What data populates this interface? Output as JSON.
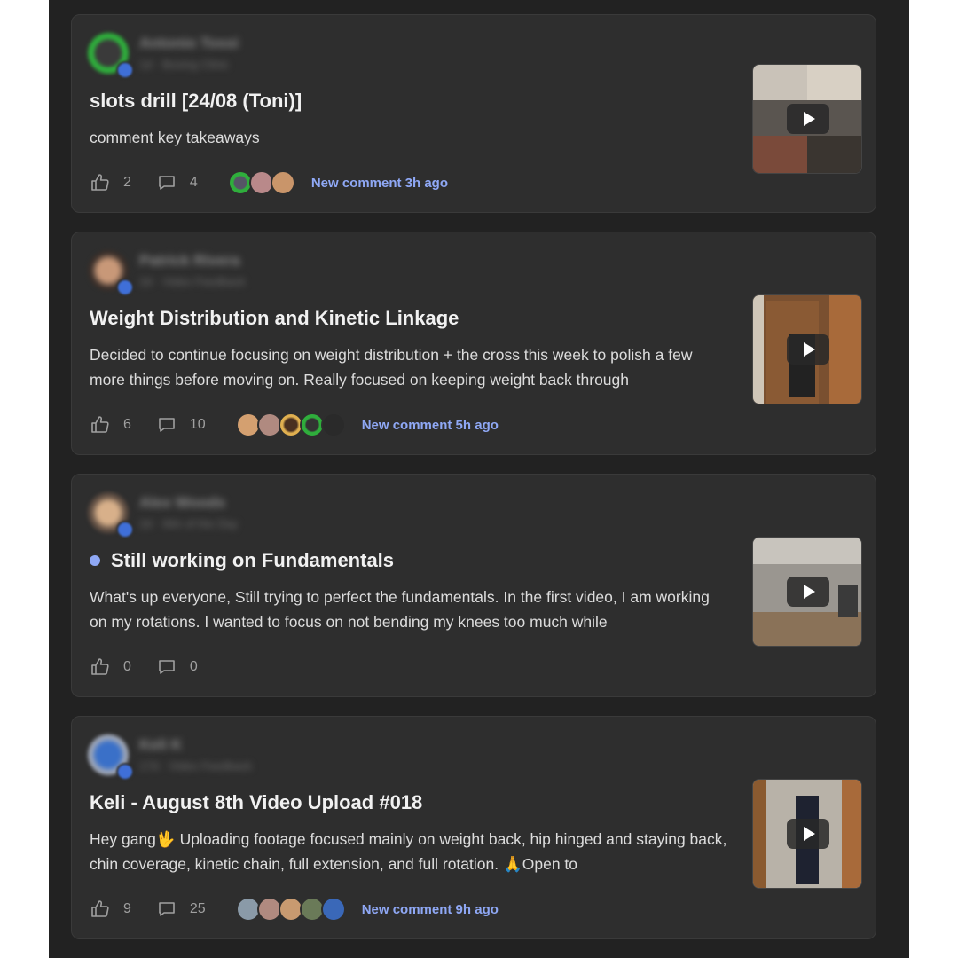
{
  "posts": [
    {
      "author_name": "Antonio Tossi",
      "author_meta": "1d · Boxing Clinic",
      "title": "slots drill [24/08 (Toni)]",
      "unread": false,
      "body": "comment key takeaways",
      "likes": "2",
      "comments": "4",
      "commenter_icons": [
        "avatar",
        "avatar",
        "avatar"
      ],
      "new_comment": "New comment 3h ago"
    },
    {
      "author_name": "Patrick Rivera",
      "author_meta": "2d · Video Feedback",
      "title": "Weight Distribution and Kinetic Linkage",
      "unread": false,
      "body": "Decided to continue focusing on weight distribution + the cross this week to polish a few more things before moving on. Really focused on keeping weight back through",
      "likes": "6",
      "comments": "10",
      "commenter_icons": [
        "avatar",
        "avatar",
        "avatar",
        "avatar",
        "avatar"
      ],
      "new_comment": "New comment 5h ago"
    },
    {
      "author_name": "Alex Woods",
      "author_meta": "2d · Win of the Day",
      "title": "Still working on Fundamentals",
      "unread": true,
      "body": "What's up everyone, Still trying to perfect the fundamentals. In the first video, I am working on my rotations. I wanted to focus on not bending my knees too much while",
      "likes": "0",
      "comments": "0",
      "commenter_icons": [],
      "new_comment": ""
    },
    {
      "author_name": "Keli K",
      "author_meta": "17d · Video Feedback",
      "title": "Keli - August 8th Video Upload #018",
      "unread": false,
      "body": "Hey gang🖖 Uploading footage focused mainly on weight back, hip hinged and staying back, chin coverage, kinetic chain, full extension, and full rotation. 🙏Open to",
      "likes": "9",
      "comments": "25",
      "commenter_icons": [
        "avatar",
        "avatar",
        "avatar",
        "avatar",
        "avatar"
      ],
      "new_comment": "New comment 9h ago"
    }
  ],
  "colors": {
    "background": "#222222",
    "card": "#2e2e2e",
    "accent": "#8fa8f5",
    "title": "#f1f1f1",
    "body": "#dcdcdc"
  },
  "icons": {
    "like": "thumbs-up-icon",
    "comment": "speech-bubble-icon",
    "play": "play-icon"
  }
}
